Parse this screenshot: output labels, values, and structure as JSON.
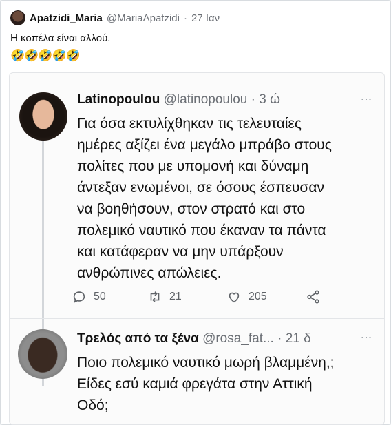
{
  "post": {
    "author_name": "Apatzidi_Maria",
    "author_handle": "@MariaApatzidi",
    "separator": "·",
    "date": "27 Ιαν",
    "text": "Η κοπέλα είναι αλλού.",
    "emoji": "🤣🤣🤣🤣🤣"
  },
  "quoted": {
    "tweet1": {
      "name": "Latinopoulou",
      "handle": "@latinopoulou",
      "separator": "·",
      "time": "3 ώ",
      "lines": [
        "Για όσα εκτυλίχθηκαν τις τελευταίες",
        "ημέρες αξίζει ένα μεγάλο μπράβο στους",
        "πολίτες που με υπομονή και δύναμη",
        "άντεξαν ενωμένοι, σε όσους έσπευσαν",
        "να βοηθήσουν, στον στρατό και στο",
        "πολεμικό ναυτικό που έκαναν τα πάντα",
        "και κατάφεραν να μην υπάρξουν",
        "ανθρώπινες απώλειες."
      ],
      "replies": "50",
      "retweets": "21",
      "likes": "205"
    },
    "tweet2": {
      "name": "Τρελός από τα ξένα",
      "handle": "@rosa_fat...",
      "separator": "·",
      "time": "21 δ",
      "lines": [
        "Ποιο πολεμικό ναυτικό μωρή βλαμμένη,;",
        "Είδες εσύ καμιά φρεγάτα στην Αττική",
        "Οδό;"
      ]
    }
  }
}
